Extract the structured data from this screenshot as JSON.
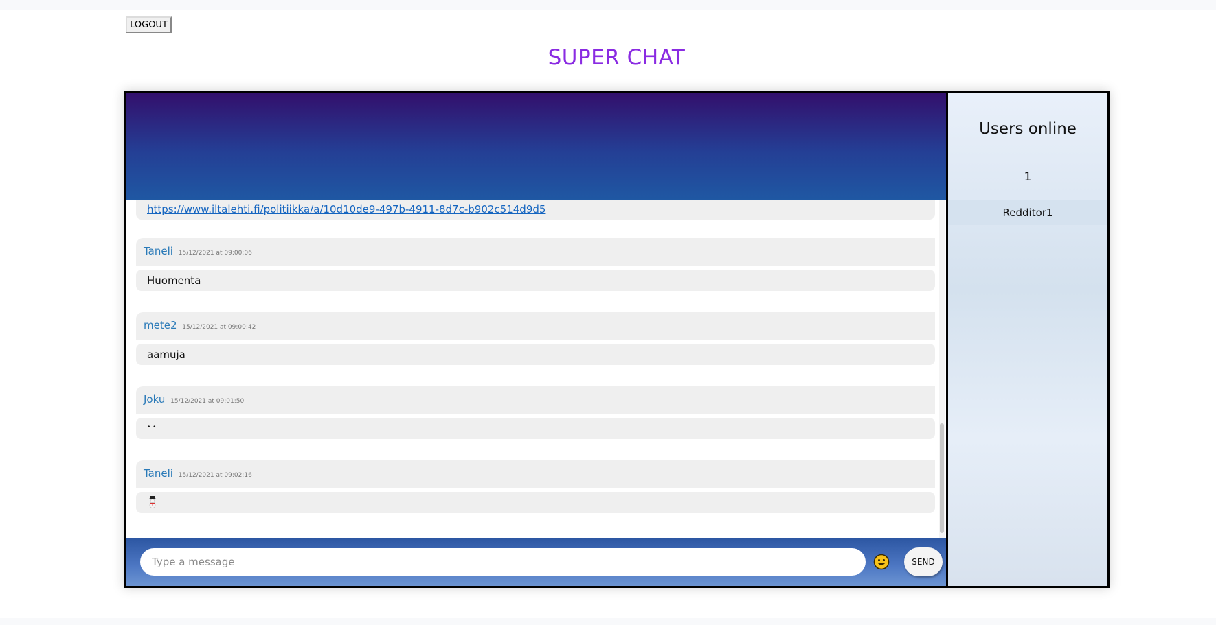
{
  "header": {
    "logout_label": "LOGOUT",
    "title": "SUPER CHAT"
  },
  "messages": {
    "first_body": {
      "link": "https://www.iltalehti.fi/politiikka/a/10d10de9-497b-4911-8d7c-b902c514d9d5"
    },
    "items": [
      {
        "author": "Taneli",
        "timestamp": "15/12/2021 at 09:00:06",
        "text": "Huomenta"
      },
      {
        "author": "mete2",
        "timestamp": "15/12/2021 at 09:00:42",
        "text": "aamuja"
      },
      {
        "author": "Joku",
        "timestamp": "15/12/2021 at 09:01:50",
        "text": "• •"
      },
      {
        "author": "Taneli",
        "timestamp": "15/12/2021 at 09:02:16",
        "text": "",
        "emoji": "snowman-icon"
      }
    ]
  },
  "composer": {
    "placeholder": "Type a message",
    "value": "",
    "emoji_icon": "smiley-icon",
    "send_label": "SEND"
  },
  "sidebar": {
    "title": "Users online",
    "count": "1",
    "users": [
      "Redditor1"
    ]
  },
  "colors": {
    "title": "#8a2be2",
    "author": "#2a7ab8",
    "link": "#1565c0",
    "header_top": "#330f6c",
    "header_bottom": "#1f58a3"
  }
}
